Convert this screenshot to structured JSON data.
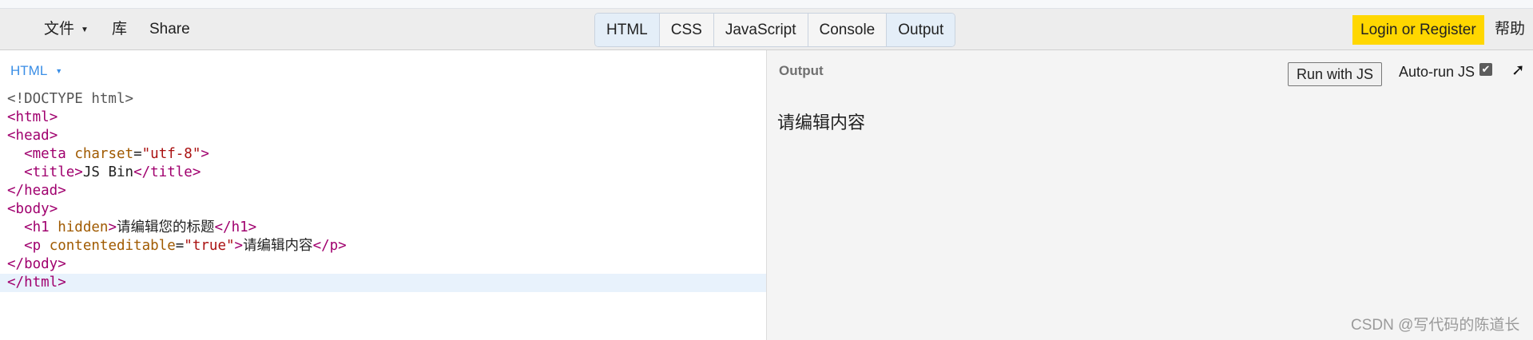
{
  "topbar": {
    "menus": [
      "文件",
      "库",
      "Share"
    ],
    "tabs": [
      "HTML",
      "CSS",
      "JavaScript",
      "Console",
      "Output"
    ],
    "active_tabs": [
      "HTML",
      "Output"
    ],
    "login": "Login or Register",
    "help": "帮助"
  },
  "editor": {
    "mode": "HTML",
    "lines": [
      "<!DOCTYPE html>",
      "<html>",
      "<head>",
      "  <meta charset=\"utf-8\">",
      "  <title>JS Bin</title>",
      "</head>",
      "<body>",
      "  <h1 hidden>请编辑您的标题</h1>",
      "  <p contenteditable=\"true\">请编辑内容</p>",
      "</body>",
      "</html>"
    ]
  },
  "output": {
    "label": "Output",
    "run_button": "Run with JS",
    "autorun_label": "Auto-run JS",
    "autorun_checked": true,
    "content": "请编辑内容"
  },
  "watermark": "CSDN @写代码的陈道长",
  "colors": {
    "login_bg": "#ffd700",
    "mode_link": "#3a8ee6",
    "tag": "#a0006e"
  }
}
